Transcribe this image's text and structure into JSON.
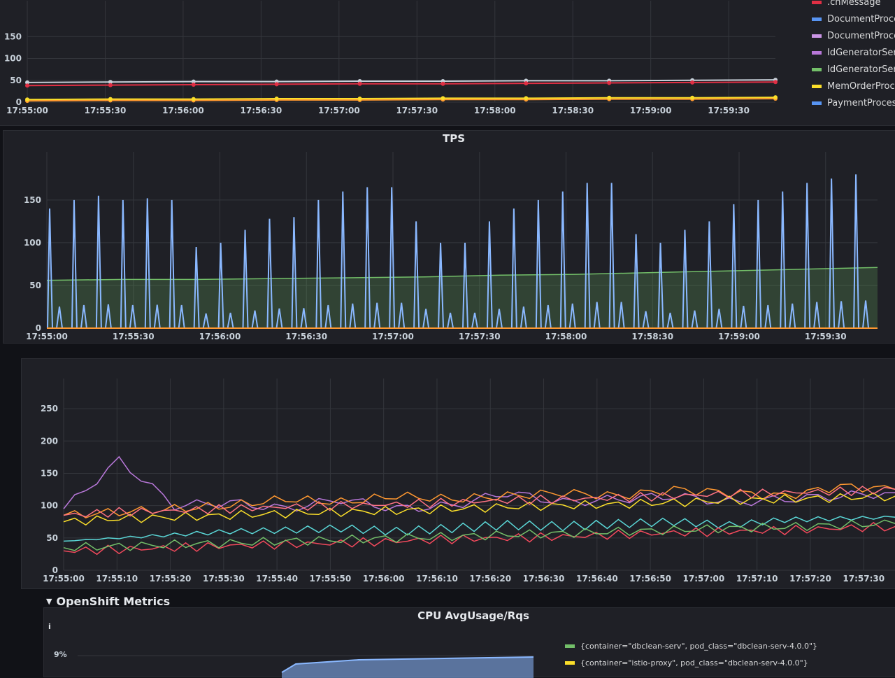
{
  "panels": {
    "top": {
      "legend": [
        {
          "label": ".chMessage",
          "color": "#e02f44"
        },
        {
          "label": "DocumentProces",
          "color": "#5794f2"
        },
        {
          "label": "DocumentProces",
          "color": "#ca95e5"
        },
        {
          "label": "IdGeneratorServic",
          "color": "#b877d9"
        },
        {
          "label": "IdGeneratorServic",
          "color": "#73bf69"
        },
        {
          "label": "MemOrderProces",
          "color": "#fade2a"
        },
        {
          "label": "PaymentProcesso",
          "color": "#5794f2"
        }
      ]
    },
    "tps": {
      "title": "TPS"
    },
    "latency": {},
    "openshift_row": {
      "title": "OpenShift Metrics"
    },
    "cpu": {
      "title": "CPU AvgUsage/Rqs",
      "y_tick_top": "9%",
      "info_icon": "i",
      "legend": [
        {
          "label": "{container=\"dbclean-serv\", pod_class=\"dbclean-serv-4.0.0\"}",
          "color": "#73bf69"
        },
        {
          "label": "{container=\"istio-proxy\", pod_class=\"dbclean-serv-4.0.0\"}",
          "color": "#fade2a"
        }
      ]
    }
  },
  "chart_data": [
    {
      "type": "line",
      "title": "",
      "yticks": [
        0,
        50,
        100,
        150
      ],
      "ylim": [
        0,
        200
      ],
      "x": [
        "17:55:00",
        "17:55:30",
        "17:56:00",
        "17:56:30",
        "17:57:00",
        "17:57:30",
        "17:58:00",
        "17:58:30",
        "17:59:00",
        "17:59:30"
      ],
      "series": [
        {
          "color": "#c7d0d9",
          "values": [
            45,
            46,
            47,
            47,
            48,
            48,
            49,
            49,
            50,
            51
          ]
        },
        {
          "color": "#e02f44",
          "values": [
            38,
            39,
            40,
            41,
            42,
            42,
            43,
            44,
            45,
            46
          ]
        },
        {
          "color": "#ff9830",
          "values": [
            3,
            4,
            4,
            5,
            5,
            6,
            6,
            7,
            7,
            8
          ]
        },
        {
          "color": "#fade2a",
          "values": [
            6,
            7,
            7,
            8,
            8,
            9,
            9,
            10,
            10,
            11
          ]
        }
      ]
    },
    {
      "type": "area",
      "title": "TPS",
      "yticks": [
        0,
        50,
        100,
        150
      ],
      "ylim": [
        0,
        190
      ],
      "x": [
        "17:55:00",
        "17:55:30",
        "17:56:00",
        "17:56:30",
        "17:57:00",
        "17:57:30",
        "17:58:00",
        "17:58:30",
        "17:59:00",
        "17:59:30"
      ],
      "series": [
        {
          "color": "#73bf69",
          "values": [
            56,
            57,
            57,
            58,
            59,
            60,
            62,
            63,
            65,
            67,
            69,
            71
          ]
        },
        {
          "color": "#8ab8ff",
          "spikes": [
            140,
            150,
            155,
            150,
            152,
            150,
            95,
            100,
            115,
            128,
            130,
            150,
            160,
            165,
            165,
            125,
            100,
            100,
            125,
            140,
            150,
            160,
            170,
            170,
            110,
            100,
            115,
            125,
            145,
            150,
            160,
            170,
            175,
            180
          ]
        },
        {
          "color": "#ff9830",
          "values": [
            0,
            0,
            0,
            0,
            0,
            0,
            0,
            0,
            0,
            0,
            0,
            0
          ]
        }
      ]
    },
    {
      "type": "line",
      "title": "",
      "yticks": [
        0,
        50,
        100,
        150,
        200,
        250
      ],
      "ylim": [
        0,
        275
      ],
      "x": [
        "17:55:00",
        "17:55:10",
        "17:55:20",
        "17:55:30",
        "17:55:40",
        "17:55:50",
        "17:56:00",
        "17:56:10",
        "17:56:20",
        "17:56:30",
        "17:56:40",
        "17:56:50",
        "17:57:00",
        "17:57:10",
        "17:57:20",
        "17:57:30"
      ],
      "series": [
        {
          "color": "#b877d9",
          "values": [
            95,
            170,
            100,
            105,
            95,
            110,
            95,
            100,
            120,
            105,
            110,
            115,
            105,
            110,
            115,
            120
          ]
        },
        {
          "color": "#ff9830",
          "values": [
            85,
            90,
            95,
            100,
            110,
            105,
            115,
            110,
            115,
            120,
            115,
            125,
            120,
            115,
            130,
            125
          ]
        },
        {
          "color": "#fade2a",
          "values": [
            75,
            80,
            82,
            85,
            88,
            90,
            92,
            95,
            98,
            100,
            102,
            105,
            108,
            110,
            112,
            115
          ]
        },
        {
          "color": "#ff7383",
          "values": [
            85,
            90,
            92,
            95,
            98,
            100,
            102,
            105,
            108,
            110,
            112,
            115,
            118,
            120,
            122,
            125
          ]
        },
        {
          "color": "#5ad6d6",
          "values": [
            45,
            50,
            55,
            60,
            62,
            65,
            60,
            65,
            70,
            68,
            72,
            75,
            70,
            78,
            80,
            82
          ]
        },
        {
          "color": "#f2495c",
          "values": [
            30,
            32,
            35,
            38,
            40,
            42,
            45,
            48,
            50,
            52,
            55,
            58,
            60,
            62,
            65,
            68
          ]
        },
        {
          "color": "#73bf69",
          "values": [
            35,
            37,
            40,
            42,
            45,
            47,
            50,
            52,
            55,
            57,
            60,
            62,
            65,
            67,
            70,
            72
          ]
        }
      ]
    }
  ]
}
